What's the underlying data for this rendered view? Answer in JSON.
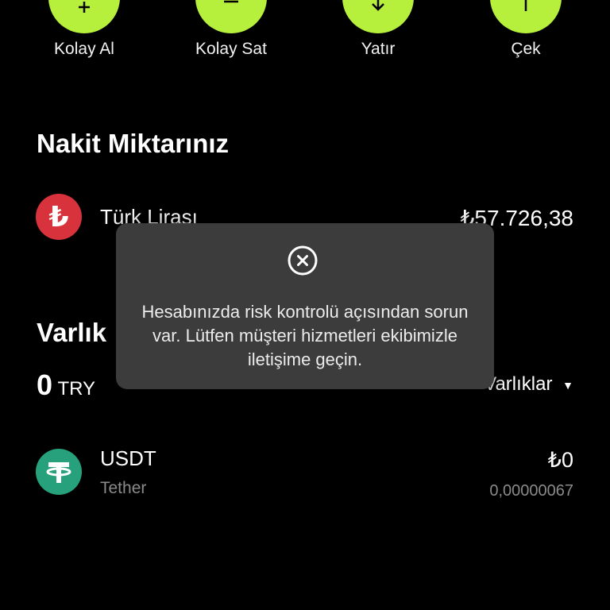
{
  "actions": [
    {
      "label": "Kolay Al",
      "icon": "plus-icon"
    },
    {
      "label": "Kolay Sat",
      "icon": "minus-icon"
    },
    {
      "label": "Yatır",
      "icon": "deposit-arrow-down-icon"
    },
    {
      "label": "Çek",
      "icon": "withdraw-arrow-up-icon"
    }
  ],
  "cash": {
    "title": "Nakit Miktarınız",
    "currency_name": "Türk Lirası",
    "currency_symbol": "₺",
    "amount": "₺57.726,38"
  },
  "assets": {
    "title": "Varlık",
    "total_value": "0",
    "total_unit": "TRY",
    "filter_label": "Varlıklar",
    "items": [
      {
        "symbol": "USDT",
        "name": "Tether",
        "value": "₺0",
        "quantity": "0,00000067"
      }
    ]
  },
  "modal": {
    "message": "Hesabınızda risk kontrolü açısından sorun var. Lütfen müşteri hizmetleri ekibimizle iletişime geçin."
  },
  "colors": {
    "accent": "#b6f03d",
    "background": "#000000",
    "try_badge": "#d8323c",
    "usdt_badge": "#26a17b",
    "modal_bg": "#3c3c3c"
  }
}
